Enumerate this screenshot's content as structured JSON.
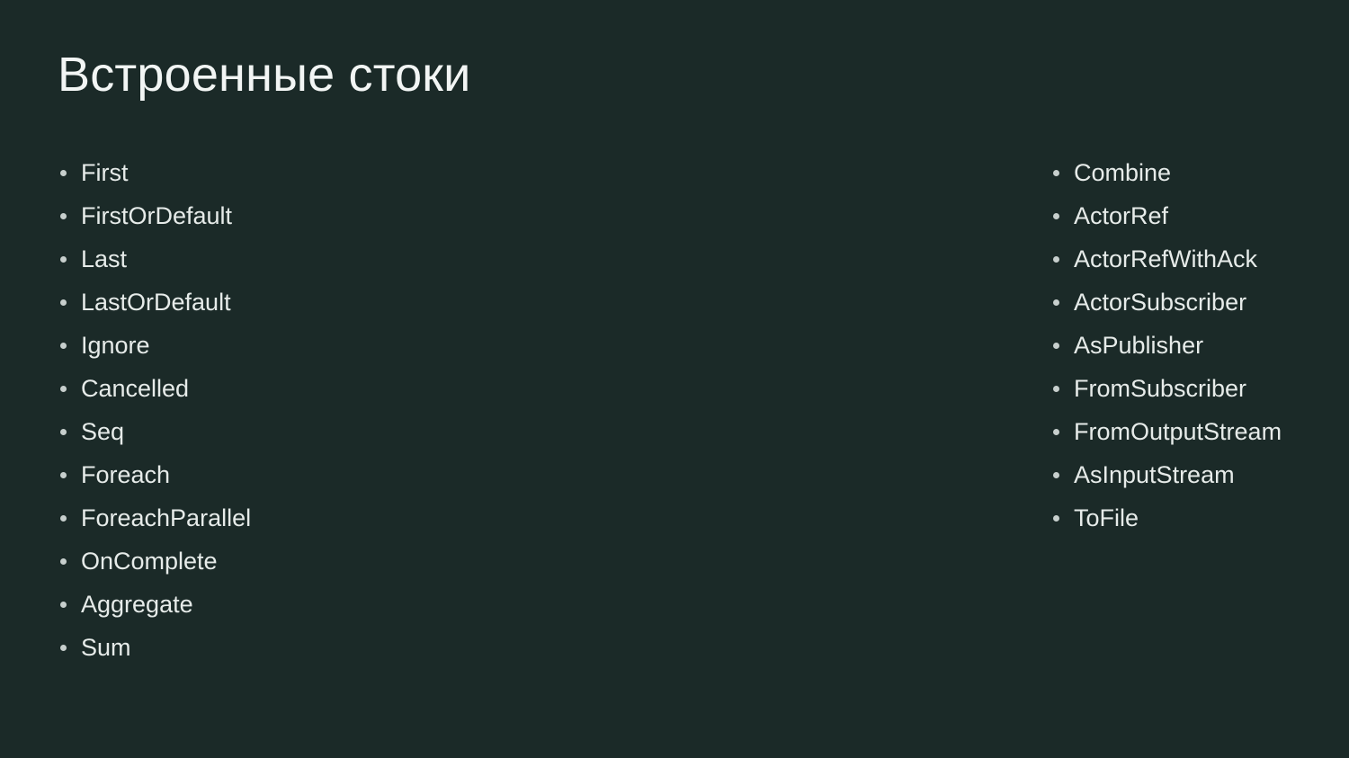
{
  "slide": {
    "title": "Встроенные стоки",
    "background_color": "#1b2a28",
    "title_color": "#f2f5f4",
    "text_color": "#e6ebe9",
    "bullet_color": "#c7cfcd"
  },
  "columns": [
    {
      "name": "left-column",
      "items": [
        {
          "label": "First"
        },
        {
          "label": "FirstOrDefault"
        },
        {
          "label": "Last"
        },
        {
          "label": "LastOrDefault"
        },
        {
          "label": "Ignore"
        },
        {
          "label": "Cancelled"
        },
        {
          "label": "Seq"
        },
        {
          "label": "Foreach"
        },
        {
          "label": "ForeachParallel"
        },
        {
          "label": "OnComplete"
        },
        {
          "label": "Aggregate"
        },
        {
          "label": "Sum"
        }
      ]
    },
    {
      "name": "right-column",
      "items": [
        {
          "label": "Combine"
        },
        {
          "label": "ActorRef"
        },
        {
          "label": "ActorRefWithAck"
        },
        {
          "label": "ActorSubscriber"
        },
        {
          "label": "AsPublisher"
        },
        {
          "label": "FromSubscriber"
        },
        {
          "label": "FromOutputStream"
        },
        {
          "label": "AsInputStream"
        },
        {
          "label": "ToFile"
        }
      ]
    }
  ]
}
